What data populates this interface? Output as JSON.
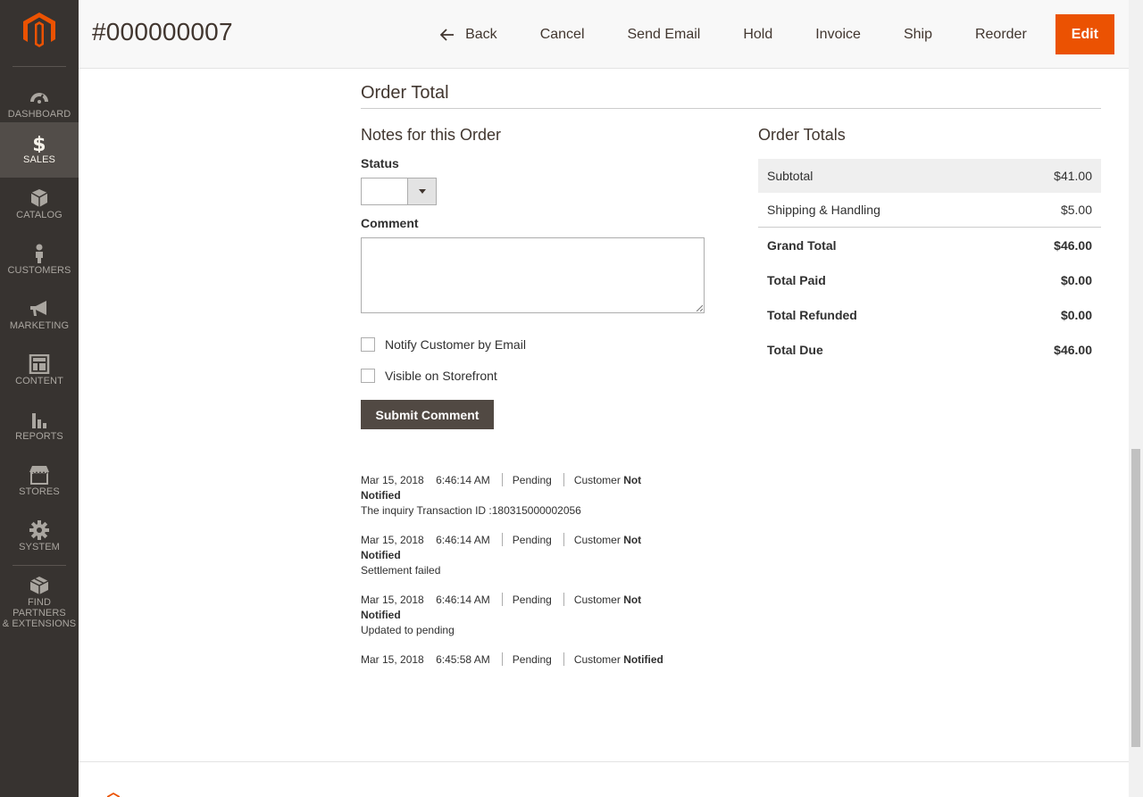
{
  "sidebar": {
    "items": [
      {
        "label": "DASHBOARD",
        "icon": "dashboard-icon"
      },
      {
        "label": "SALES",
        "icon": "dollar-icon",
        "active": true
      },
      {
        "label": "CATALOG",
        "icon": "box-icon"
      },
      {
        "label": "CUSTOMERS",
        "icon": "person-icon"
      },
      {
        "label": "MARKETING",
        "icon": "megaphone-icon"
      },
      {
        "label": "CONTENT",
        "icon": "layout-icon"
      },
      {
        "label": "REPORTS",
        "icon": "bar-chart-icon"
      },
      {
        "label": "STORES",
        "icon": "store-icon"
      },
      {
        "label": "SYSTEM",
        "icon": "gear-icon"
      },
      {
        "label": "FIND PARTNERS\n& EXTENSIONS",
        "label_line1": "FIND PARTNERS",
        "label_line2": "& EXTENSIONS",
        "icon": "cube-icon"
      }
    ]
  },
  "header": {
    "title": "#000000007",
    "buttons": {
      "back": "Back",
      "cancel": "Cancel",
      "send_email": "Send Email",
      "hold": "Hold",
      "invoice": "Invoice",
      "ship": "Ship",
      "reorder": "Reorder",
      "edit": "Edit"
    }
  },
  "main": {
    "section_title": "Order Total",
    "notes": {
      "title": "Notes for this Order",
      "status_label": "Status",
      "status_value": "",
      "comment_label": "Comment",
      "comment_value": "",
      "notify_label": "Notify Customer by Email",
      "visible_label": "Visible on Storefront",
      "submit_label": "Submit Comment"
    },
    "history": [
      {
        "date": "Mar 15, 2018",
        "time": "6:46:14 AM",
        "status": "Pending",
        "customer_prefix": "Customer",
        "notified": "Not Notified",
        "notified_word1": "Not",
        "notified_word2": "Notified",
        "comment": "The inquiry Transaction ID :180315000002056"
      },
      {
        "date": "Mar 15, 2018",
        "time": "6:46:14 AM",
        "status": "Pending",
        "customer_prefix": "Customer",
        "notified": "Not Notified",
        "notified_word1": "Not",
        "notified_word2": "Notified",
        "comment": "Settlement failed"
      },
      {
        "date": "Mar 15, 2018",
        "time": "6:46:14 AM",
        "status": "Pending",
        "customer_prefix": "Customer",
        "notified": "Not Notified",
        "notified_word1": "Not",
        "notified_word2": "Notified",
        "comment": "Updated to pending"
      },
      {
        "date": "Mar 15, 2018",
        "time": "6:45:58 AM",
        "status": "Pending",
        "customer_prefix": "Customer",
        "notified": "Notified",
        "notified_word1": "Notified",
        "notified_word2": "",
        "comment": ""
      }
    ],
    "totals": {
      "title": "Order Totals",
      "rows": [
        {
          "label": "Subtotal",
          "value": "$41.00"
        },
        {
          "label": "Shipping & Handling",
          "value": "$5.00"
        },
        {
          "label": "Grand Total",
          "value": "$46.00"
        },
        {
          "label": "Total Paid",
          "value": "$0.00"
        },
        {
          "label": "Total Refunded",
          "value": "$0.00"
        },
        {
          "label": "Total Due",
          "value": "$46.00"
        }
      ]
    }
  },
  "colors": {
    "sidebar_bg": "#373330",
    "sidebar_active": "#524d49",
    "brand_orange": "#eb5202",
    "button_dark": "#514943"
  }
}
